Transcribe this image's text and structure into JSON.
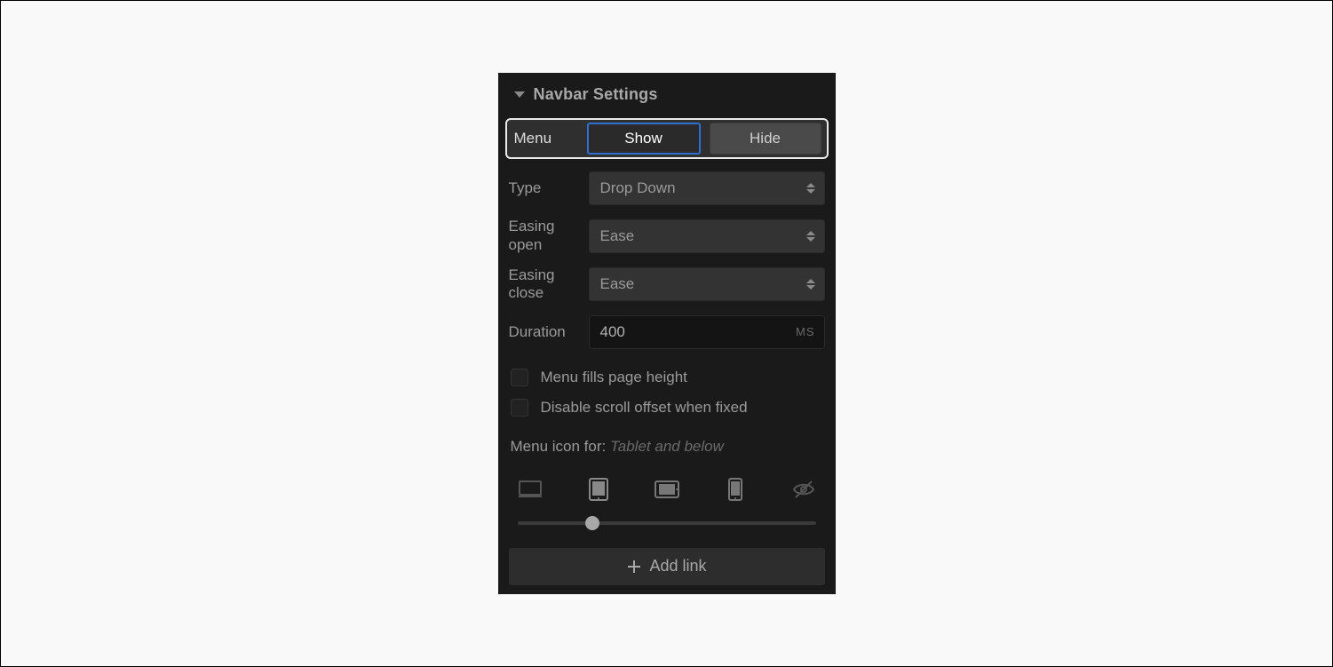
{
  "header": {
    "title": "Navbar Settings"
  },
  "menu": {
    "label": "Menu",
    "show_label": "Show",
    "hide_label": "Hide",
    "active": "Show"
  },
  "type": {
    "label": "Type",
    "value": "Drop Down"
  },
  "easing_open": {
    "label": "Easing open",
    "value": "Ease"
  },
  "easing_close": {
    "label": "Easing close",
    "value": "Ease"
  },
  "duration": {
    "label": "Duration",
    "value": "400",
    "unit": "MS"
  },
  "checkboxes": {
    "fills_height": {
      "label": "Menu fills page height",
      "checked": false
    },
    "disable_scroll_offset": {
      "label": "Disable scroll offset when fixed",
      "checked": false
    }
  },
  "menu_icon": {
    "label_prefix": "Menu icon for: ",
    "selection": "Tablet and below"
  },
  "slider": {
    "position_percent": 25
  },
  "add_link": {
    "label": "Add link"
  },
  "colors": {
    "panel_bg": "#1a1a1a",
    "accent_blue": "#2f6fd1",
    "highlight_border": "#eaeaea"
  }
}
